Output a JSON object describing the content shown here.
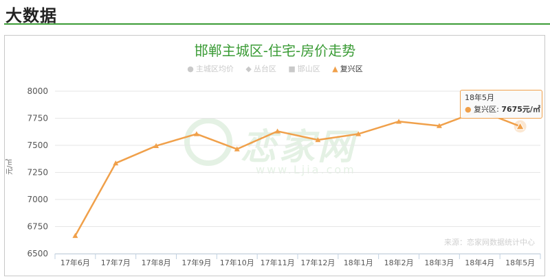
{
  "section": {
    "title": "大数据"
  },
  "chart_data": {
    "type": "line",
    "title": "邯郸主城区-住宅-房价走势",
    "ylabel": "元/㎡",
    "ylim": [
      6500,
      8000
    ],
    "yticks": [
      6500,
      6750,
      7000,
      7250,
      7500,
      7750,
      8000
    ],
    "categories": [
      "17年6月",
      "17年7月",
      "17年8月",
      "17年9月",
      "17年10月",
      "17年11月",
      "17年12月",
      "18年1月",
      "18年2月",
      "18年3月",
      "18年4月",
      "18年5月"
    ],
    "legend": [
      {
        "name": "主城区均价",
        "symbol": "●",
        "active": false
      },
      {
        "name": "丛台区",
        "symbol": "◆",
        "active": false
      },
      {
        "name": "邯山区",
        "symbol": "■",
        "active": false
      },
      {
        "name": "复兴区",
        "symbol": "▲",
        "active": true
      }
    ],
    "series": [
      {
        "name": "复兴区",
        "color": "#f0a04a",
        "values": [
          6665,
          7335,
          7495,
          7605,
          7465,
          7630,
          7550,
          7605,
          7720,
          7680,
          7820,
          7675
        ]
      }
    ],
    "grid": true,
    "legend_position": "top-center"
  },
  "tooltip": {
    "date": "18年5月",
    "series": "复兴区",
    "value": "7675元/㎡"
  },
  "watermark": {
    "text": "恋家网",
    "url": "www.Ljia.com"
  },
  "source": "来源：恋家网数据统计中心"
}
